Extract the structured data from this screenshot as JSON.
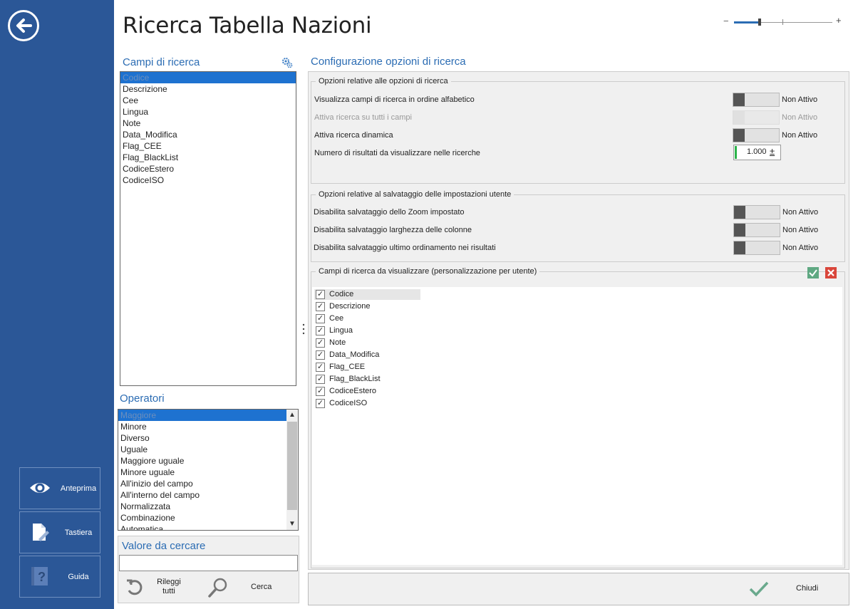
{
  "page": {
    "title": "Ricerca Tabella Nazioni"
  },
  "sidebar": {
    "buttons": [
      {
        "label": "Anteprima",
        "icon": "eye-icon"
      },
      {
        "label": "Tastiera",
        "icon": "keyboard-icon"
      },
      {
        "label": "Guida",
        "icon": "help-book-icon"
      }
    ]
  },
  "zoom": {
    "minus": "−",
    "plus": "+"
  },
  "campi": {
    "title": "Campi di ricerca",
    "items": [
      "Codice",
      "Descrizione",
      "Cee",
      "Lingua",
      "Note",
      "Data_Modifica",
      "Flag_CEE",
      "Flag_BlackList",
      "CodiceEstero",
      "CodiceISO"
    ],
    "selected": "Codice"
  },
  "operatori": {
    "title": "Operatori",
    "items": [
      "Maggiore",
      "Minore",
      "Diverso",
      "Uguale",
      "Maggiore uguale",
      "Minore uguale",
      "All'inizio del campo",
      "All'interno del campo",
      "Normalizzata",
      "Combinazione",
      "Automatica"
    ],
    "selected": "Maggiore"
  },
  "valore": {
    "title": "Valore da cercare",
    "value": "",
    "rileggi_label": "Rileggi tutti",
    "cerca_label": "Cerca"
  },
  "config": {
    "title": "Configurazione opzioni di ricerca",
    "group1": {
      "title": "Opzioni relative alle opzioni di ricerca",
      "options": [
        {
          "label": "Visualizza campi di ricerca in ordine alfabetico",
          "state": "Non Attivo",
          "enabled": true
        },
        {
          "label": "Attiva ricerca su tutti i campi",
          "state": "Non Attivo",
          "enabled": false
        },
        {
          "label": "Attiva ricerca dinamica",
          "state": "Non Attivo",
          "enabled": true
        }
      ],
      "numero_label": "Numero di risultati da visualizzare nelle ricerche",
      "numero_value": "1.000",
      "numero_pm": "±"
    },
    "group2": {
      "title": "Opzioni relative al salvataggio delle impostazioni utente",
      "options": [
        {
          "label": "Disabilita salvataggio dello Zoom impostato",
          "state": "Non Attivo"
        },
        {
          "label": "Disabilita salvataggio larghezza delle colonne",
          "state": "Non Attivo"
        },
        {
          "label": "Disabilita salvataggio ultimo ordinamento nei risultati",
          "state": "Non Attivo"
        }
      ]
    },
    "group3": {
      "title": "Campi di ricerca da visualizzare (personalizzazione per utente)",
      "fields": [
        {
          "label": "Codice",
          "checked": true
        },
        {
          "label": "Descrizione",
          "checked": true
        },
        {
          "label": "Cee",
          "checked": true
        },
        {
          "label": "Lingua",
          "checked": true
        },
        {
          "label": "Note",
          "checked": true
        },
        {
          "label": "Data_Modifica",
          "checked": true
        },
        {
          "label": "Flag_CEE",
          "checked": true
        },
        {
          "label": "Flag_BlackList",
          "checked": true
        },
        {
          "label": "CodiceEstero",
          "checked": true
        },
        {
          "label": "CodiceISO",
          "checked": true
        }
      ]
    }
  },
  "footer": {
    "close_label": "Chiudi"
  },
  "colors": {
    "sidebar": "#2b5797",
    "accent": "#2b6cb3",
    "selection": "#1e72d0",
    "ok": "#5fa882",
    "cancel": "#d9463b"
  }
}
